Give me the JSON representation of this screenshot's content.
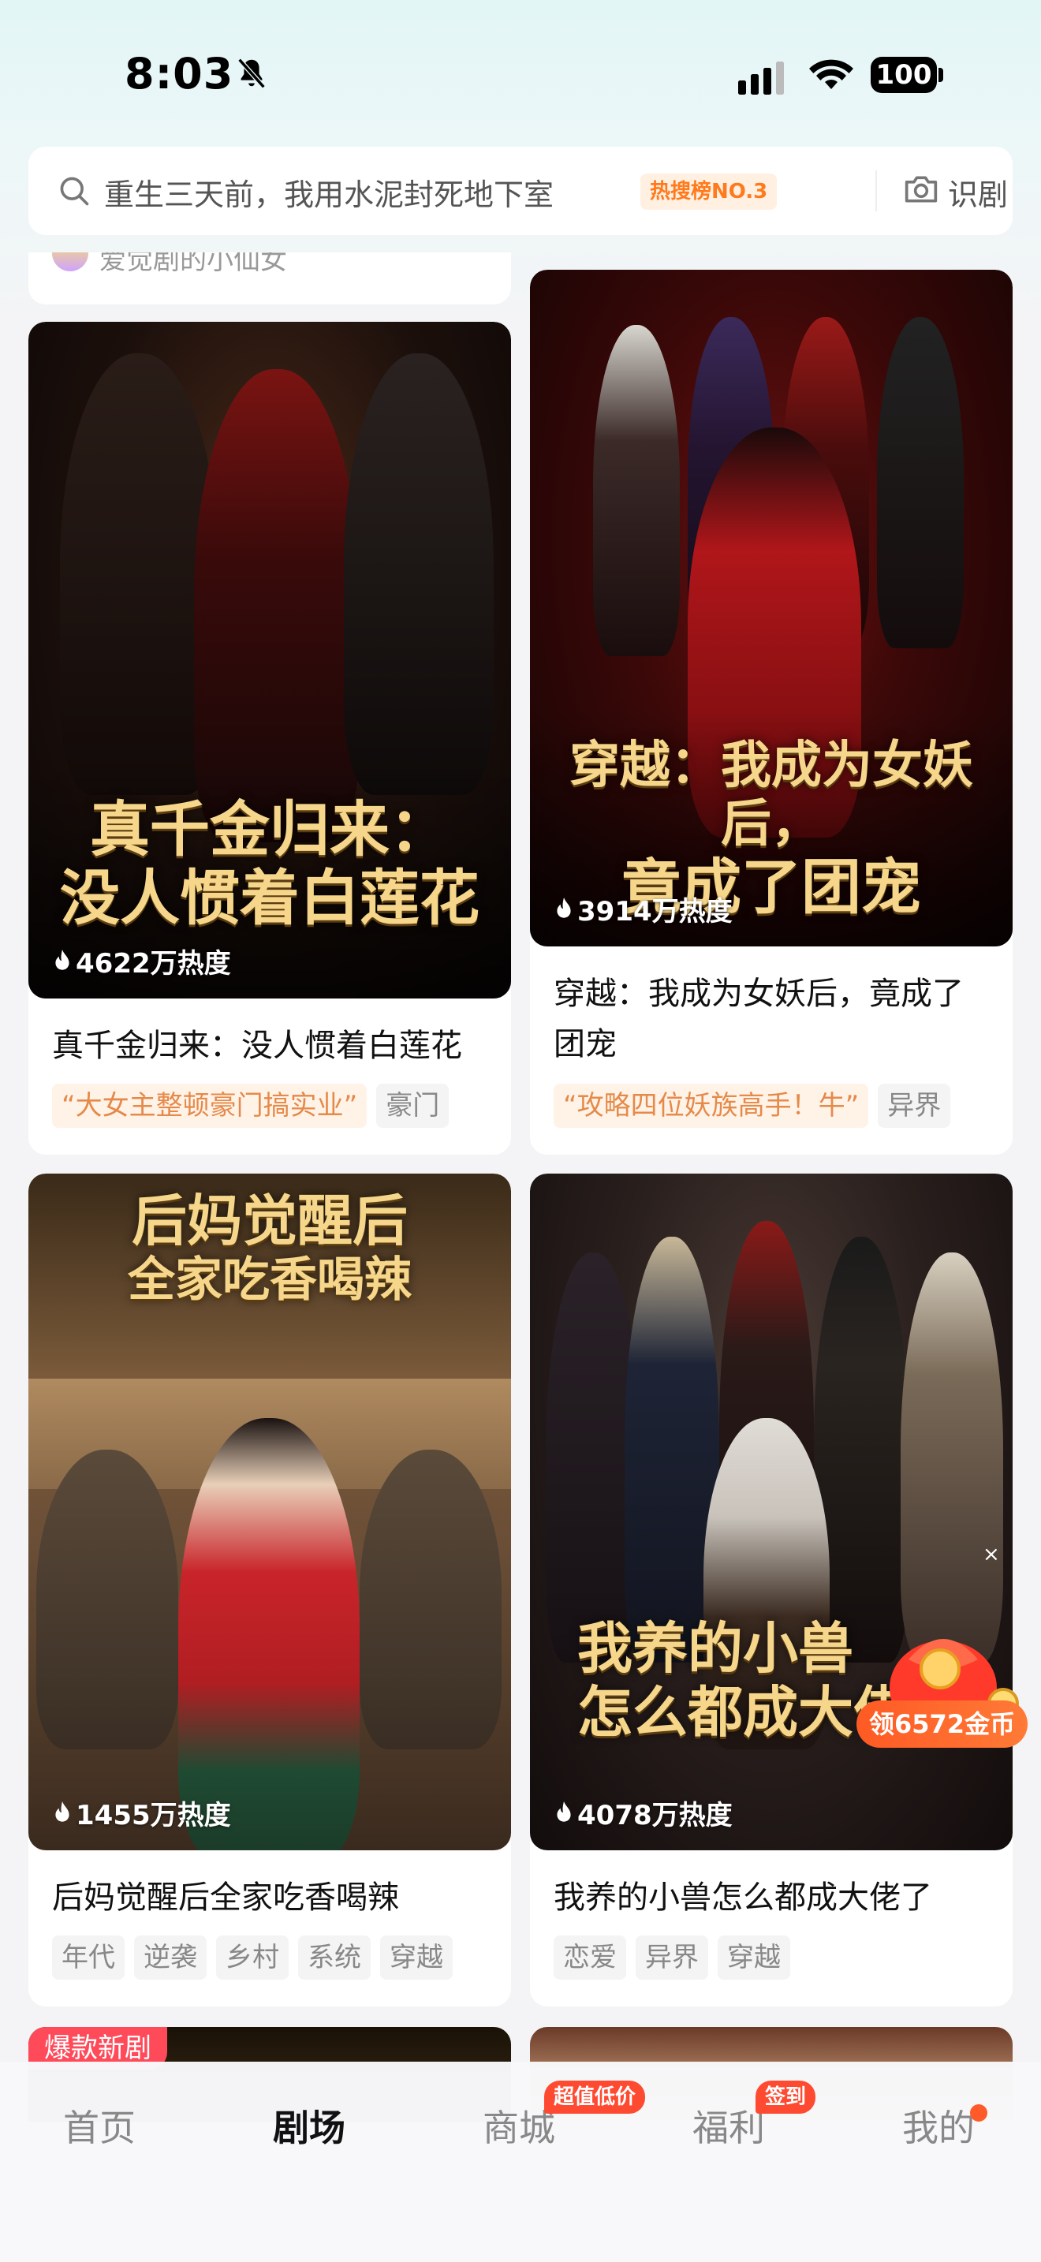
{
  "status_bar": {
    "time": "8:03",
    "battery": "100",
    "icons": [
      "bell-slash-icon",
      "signal-icon",
      "wifi-icon",
      "battery-icon"
    ]
  },
  "search": {
    "placeholder": "重生三天前，我用水泥封死地下室",
    "badge": "热搜榜NO.3",
    "recognize_label": "识剧",
    "icons": [
      "search-icon",
      "camera-icon"
    ]
  },
  "partial_card": {
    "author": "爱觉剧的小仙女"
  },
  "cards": [
    {
      "poster_text_line1": "真千金归来：",
      "poster_text_line2": "没人惯着白莲花",
      "heat": "4622万热度",
      "title": "真千金归来：没人惯着白莲花",
      "tags": [
        {
          "label": "“大女主整顿豪门搞实业”",
          "style": "orange"
        },
        {
          "label": "豪门",
          "style": "gray"
        }
      ]
    },
    {
      "poster_text_line1": "穿越：我成为女妖后，",
      "poster_text_line2": "竟成了团宠",
      "heat": "3914万热度",
      "title": "穿越：我成为女妖后，竟成了团宠",
      "tags": [
        {
          "label": "“攻略四位妖族高手！牛”",
          "style": "orange"
        },
        {
          "label": "异界",
          "style": "gray"
        }
      ]
    },
    {
      "poster_text_line1": "后妈觉醒后",
      "poster_text_line2": "全家吃香喝辣",
      "heat": "1455万热度",
      "title": "后妈觉醒后全家吃香喝辣",
      "tags": [
        {
          "label": "年代",
          "style": "gray"
        },
        {
          "label": "逆袭",
          "style": "gray"
        },
        {
          "label": "乡村",
          "style": "gray"
        },
        {
          "label": "系统",
          "style": "gray"
        },
        {
          "label": "穿越",
          "style": "gray"
        }
      ]
    },
    {
      "poster_text_line1": "我养的小兽",
      "poster_text_line2": "怎么都成大佬",
      "heat": "4078万热度",
      "title": "我养的小兽怎么都成大佬了",
      "tags": [
        {
          "label": "恋爱",
          "style": "gray"
        },
        {
          "label": "异界",
          "style": "gray"
        },
        {
          "label": "穿越",
          "style": "gray"
        }
      ]
    }
  ],
  "bottom_row": {
    "left_badge": "爆款新剧"
  },
  "coin_widget": {
    "label": "领6572金币",
    "close": "×"
  },
  "tabbar": {
    "tabs": [
      {
        "label": "首页",
        "active": false
      },
      {
        "label": "剧场",
        "active": true
      },
      {
        "label": "商城",
        "active": false,
        "badge": "超值低价"
      },
      {
        "label": "福利",
        "active": false,
        "badge": "签到"
      },
      {
        "label": "我的",
        "active": false,
        "dot": true
      }
    ]
  },
  "colors": {
    "accent_orange": "#ff7a1c",
    "badge_red": "#ff4a32",
    "tag_orange_text": "#e58a4a"
  }
}
